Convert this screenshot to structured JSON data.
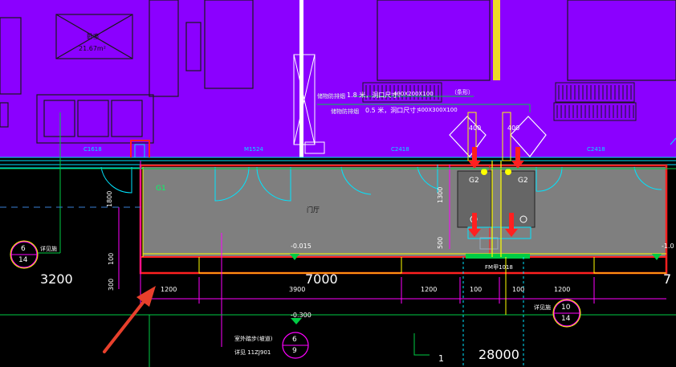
{
  "room": {
    "name": "卧室",
    "area": "21.67m²"
  },
  "notes": {
    "smoke_vent_1": "储物防排烟",
    "spec_1": "1.8 米，洞口尺寸：",
    "size_1": "400X200X100",
    "unit_1": "（条形）",
    "smoke_vent_2": "储物防排烟",
    "spec_2": "0.5 米，洞口尺寸：",
    "size_2": "400X300X100"
  },
  "windows": [
    "C1618",
    "M1524",
    "C2418",
    "C2418"
  ],
  "hall_label": "门厅",
  "labels": {
    "g1": "G1",
    "g2a": "G2",
    "g2b": "G2",
    "dim_400_left": "400",
    "dim_400_right": "400",
    "dim_1800": "1800",
    "dim_100": "100",
    "dim_300": "300",
    "dim_1300": "1300",
    "dim_500": "500",
    "elev_main": "-0.015",
    "elev_right": "-1.0",
    "elev_low": "-0.300",
    "fm_label": "FM甲1018",
    "sub_labels": [
      "1200",
      "3900",
      "1200",
      "100",
      "100",
      "1200"
    ],
    "big_dims": [
      "3200",
      "7000",
      "7",
      "28000"
    ],
    "axis_1": "1",
    "callout_left": "详见施",
    "callout_right": "详见施",
    "ramp_title": "室外踏步(坡道)",
    "ramp_ref": "详见 11ZJ901"
  },
  "detail_marks": [
    {
      "num": "6",
      "sheet": "14"
    },
    {
      "num": "10",
      "sheet": "14"
    },
    {
      "num": "6",
      "sheet": "9"
    }
  ],
  "colors": {
    "room_fill": "#8b00ff",
    "hall_fill": "#808080",
    "wall_red": "#ff2020",
    "cyan": "#00e5ff",
    "yellow": "#ffff00",
    "magenta": "#ff00ff",
    "green": "#00cc44",
    "arrow": "#e8402c"
  }
}
